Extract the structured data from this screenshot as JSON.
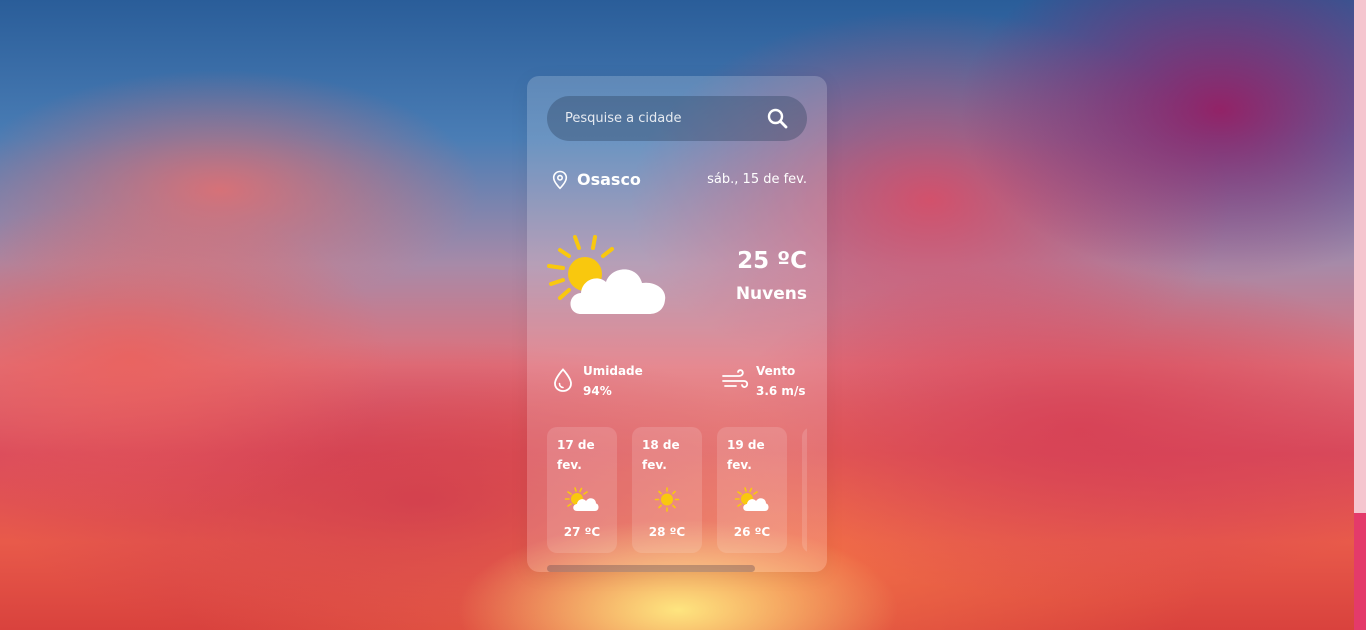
{
  "search": {
    "placeholder": "Pesquise a cidade",
    "icon": "search-icon"
  },
  "location": {
    "city": "Osasco",
    "date": "sáb., 15 de fev.",
    "icon": "location-pin-icon"
  },
  "current": {
    "temperature": "25 ºC",
    "description": "Nuvens",
    "icon": "partly-cloudy-icon"
  },
  "details": {
    "humidity_label": "Umidade",
    "humidity_value": "94%",
    "humidity_icon": "droplet-icon",
    "wind_label": "Vento",
    "wind_value": "3.6 m/s",
    "wind_icon": "wind-icon"
  },
  "forecast": [
    {
      "date": "17 de fev.",
      "temp": "27 ºC",
      "icon": "partly-cloudy-icon"
    },
    {
      "date": "18 de fev.",
      "temp": "28 ºC",
      "icon": "sun-icon"
    },
    {
      "date": "19 de fev.",
      "temp": "26 ºC",
      "icon": "partly-cloudy-icon"
    }
  ],
  "colors": {
    "sun": "#f9c80e",
    "cloud": "#ffffff",
    "text": "#ffffff"
  }
}
